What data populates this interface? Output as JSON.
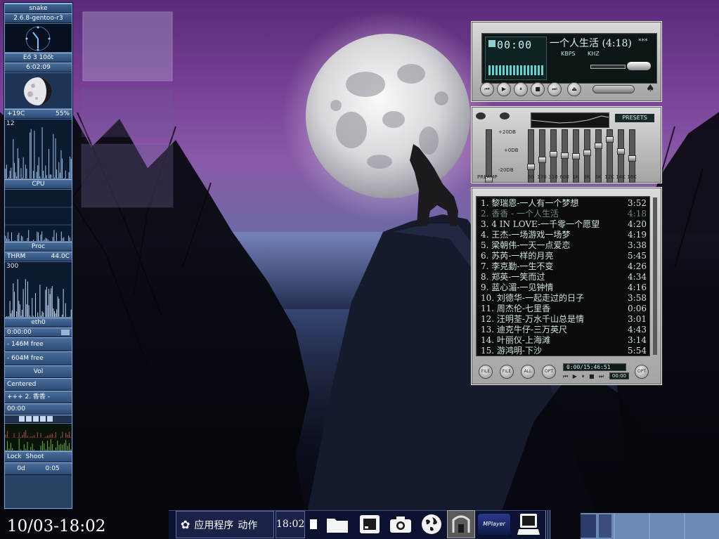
{
  "gkrellm": {
    "hostname": "snake",
    "kernel": "2.6.8-gentoo-r3",
    "uptime_row": "Eő 3 10őt",
    "time": "6:02:09",
    "temp": "+19C",
    "humidity": "55%",
    "chart_scale": "12",
    "cpu_label": "CPU",
    "proc_label": "Proc",
    "thrm_label": "THRM",
    "thrm_value": "44.0C",
    "proc_scale": "300",
    "net_label": "eth0",
    "net_time": "0:00:00",
    "mem_free": "- 146M free",
    "swap_free": "- 604M free",
    "vol_label": "Vol",
    "vol_mode": "Centered",
    "track_scroll": "+++ 2. 香香 -",
    "player_time": "00:00",
    "lock_label": "Lock",
    "shoot_label": "Shoot",
    "countdown_days": "0d",
    "countdown_time": "0:05"
  },
  "desktop": {
    "clock": "10/03-18:02"
  },
  "xmms": {
    "time_display": "00:00",
    "song_title": "一个人生活 (4:18)",
    "kbps_label": "KBPS",
    "khz_label": "KHZ",
    "stereo_indicator": "***",
    "presets_label": "PRESETS",
    "preamp_label": "PREAMP",
    "eq_db_top": "+20DB",
    "eq_db_mid": "+0DB",
    "eq_db_bottom": "-20DB",
    "eq_bands": [
      "60",
      "170",
      "310",
      "600",
      "1K",
      "3K",
      "6K",
      "12K",
      "14K",
      "16K"
    ],
    "eq_levels": [
      0.28,
      0.42,
      0.55,
      0.52,
      0.5,
      0.58,
      0.72,
      0.86,
      0.6,
      0.45
    ],
    "preamp_level": 0.0,
    "pl_position": "0:00/15:46:51",
    "pl_footer_time": "00:00",
    "pl_buttons": [
      "FILE",
      "FILE",
      "ALL",
      "OPT",
      "OPT"
    ],
    "playlist": [
      {
        "title": "1. 黎瑞恩-一人有一个梦想",
        "length": "3:52"
      },
      {
        "title": "2. 香香 - 一个人生活",
        "length": "4:18"
      },
      {
        "title": "3. 4 IN LOVE-一千零一个愿望",
        "length": "4:20"
      },
      {
        "title": "4. 王杰-一场游戏一场梦",
        "length": "4:19"
      },
      {
        "title": "5. 梁朝伟-一天一点爱恋",
        "length": "3:38"
      },
      {
        "title": "6. 苏芮-一样的月亮",
        "length": "5:45"
      },
      {
        "title": "7. 李克勤-一生不变",
        "length": "4:26"
      },
      {
        "title": "8. 郑英-一笑而过",
        "length": "4:34"
      },
      {
        "title": "9. 蓝心湄-一见钟情",
        "length": "4:16"
      },
      {
        "title": "10. 刘德华-一起走过的日子",
        "length": "3:58"
      },
      {
        "title": "11. 周杰伦-七里香",
        "length": "0:06"
      },
      {
        "title": "12. 汪明荃-万水千山总是情",
        "length": "3:01"
      },
      {
        "title": "13. 迪克牛仔-三万英尺",
        "length": "4:43"
      },
      {
        "title": "14. 叶丽仪-上海滩",
        "length": "3:14"
      },
      {
        "title": "15. 游鸿明-下沙",
        "length": "5:54"
      }
    ]
  },
  "panel": {
    "applications": "应用程序",
    "actions": "动作",
    "clock": "18:02",
    "mplayer_label": "MPlayer"
  }
}
